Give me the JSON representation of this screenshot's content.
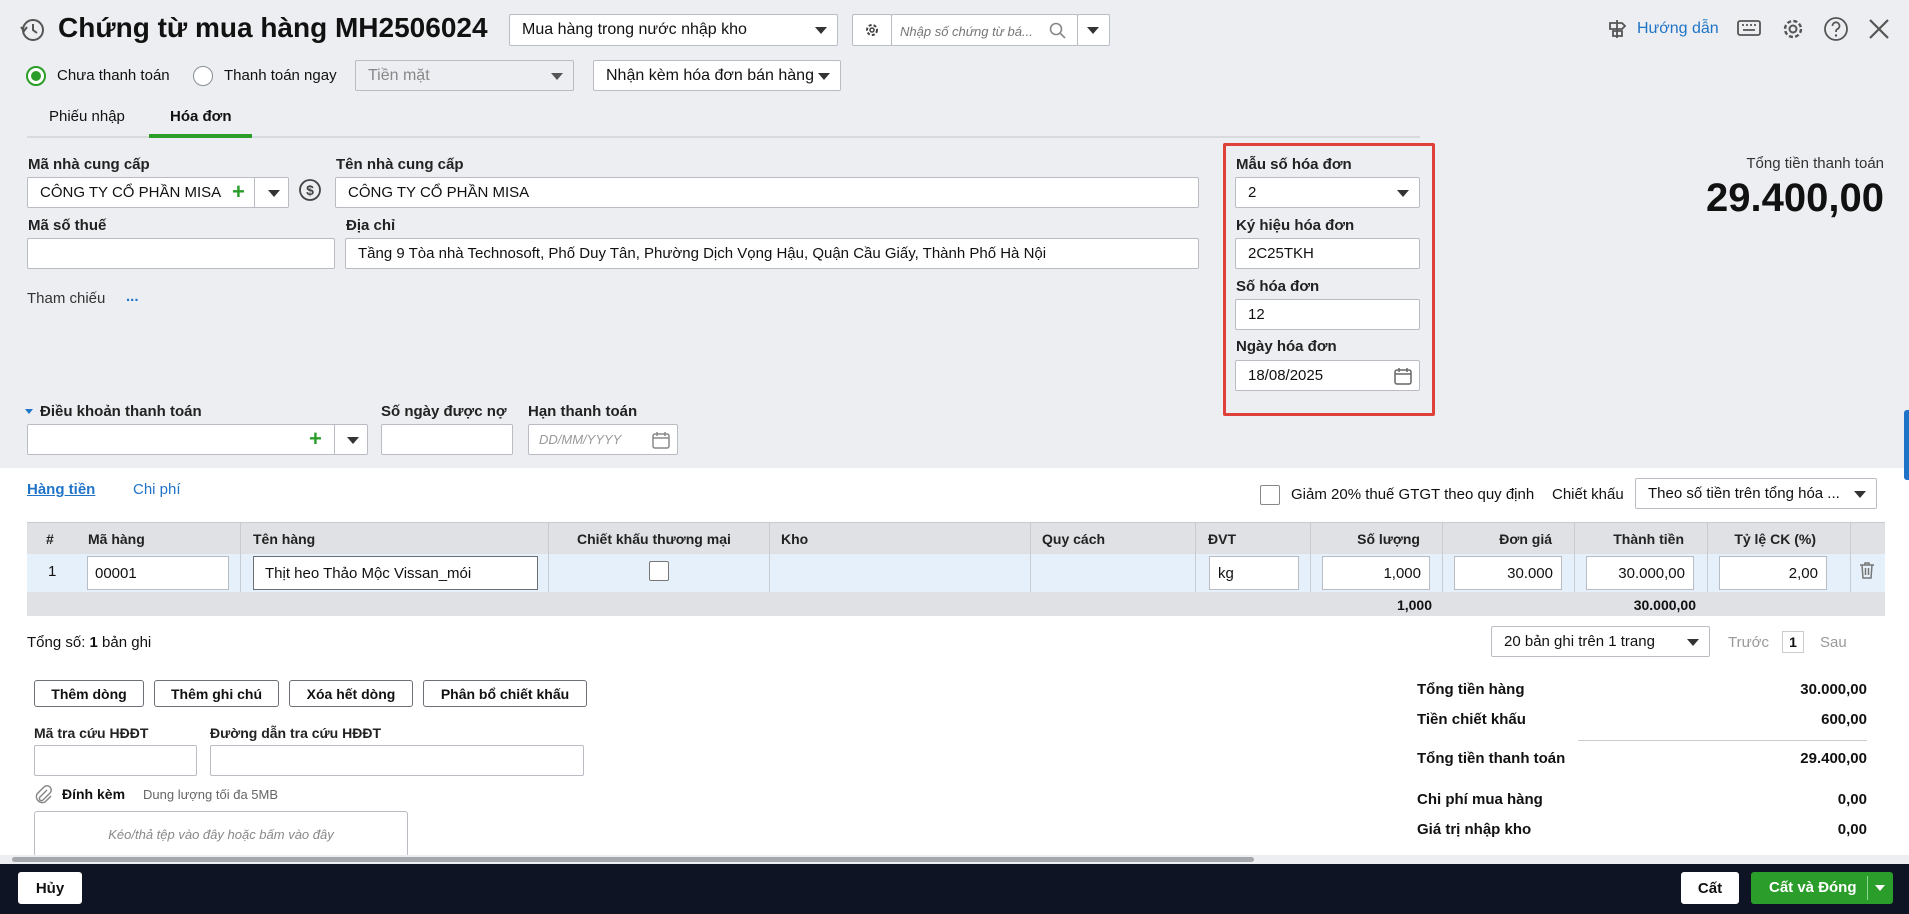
{
  "header": {
    "title": "Chứng từ mua hàng MH2506024",
    "type_select": "Mua hàng trong nước nhập kho",
    "search_placeholder": "Nhập số chứng từ bá...",
    "help_link": "Hướng dẫn"
  },
  "payment": {
    "option_unpaid": "Chưa thanh toán",
    "option_paid_now": "Thanh toán ngay",
    "method": "Tiền mặt",
    "invoice_receive": "Nhận kèm hóa đơn bán hàng"
  },
  "tabs": {
    "receipt": "Phiếu nhập",
    "invoice": "Hóa đơn"
  },
  "supplier": {
    "code_label": "Mã nhà cung cấp",
    "code_value": "CÔNG TY CỔ PHẦN MISA",
    "name_label": "Tên nhà cung cấp",
    "name_value": "CÔNG TY CỔ PHẦN MISA",
    "tax_label": "Mã số thuế",
    "tax_value": "",
    "address_label": "Địa chỉ",
    "address_value": "Tầng 9 Tòa nhà Technosoft, Phố Duy Tân, Phường Dịch Vọng Hậu, Quận Cầu Giấy, Thành Phố Hà Nội",
    "reference_label": "Tham chiếu",
    "reference_more": "..."
  },
  "invoice_info": {
    "form_label": "Mẫu số hóa đơn",
    "form_value": "2",
    "symbol_label": "Ký hiệu hóa đơn",
    "symbol_value": "2C25TKH",
    "number_label": "Số hóa đơn",
    "number_value": "12",
    "date_label": "Ngày hóa đơn",
    "date_value": "18/08/2025"
  },
  "total": {
    "label": "Tổng tiền thanh toán",
    "value": "29.400,00"
  },
  "terms": {
    "terms_label": "Điều khoản thanh toán",
    "days_label": "Số ngày được nợ",
    "due_label": "Hạn thanh toán",
    "due_placeholder": "DD/MM/YYYY"
  },
  "detail_tabs": {
    "goods": "Hàng tiền",
    "cost": "Chi phí"
  },
  "options": {
    "vat_reduce": "Giảm 20% thuế GTGT theo quy định",
    "discount_label": "Chiết khấu",
    "discount_value": "Theo số tiền trên tổng hóa ..."
  },
  "grid": {
    "columns": {
      "idx": "#",
      "code": "Mã hàng",
      "name": "Tên hàng",
      "trade_discount": "Chiết khấu thương mại",
      "warehouse": "Kho",
      "spec": "Quy cách",
      "unit": "ĐVT",
      "qty": "Số lượng",
      "price": "Đơn giá",
      "amount": "Thành tiền",
      "rate": "Tỷ lệ CK (%)"
    },
    "rows": [
      {
        "idx": "1",
        "code": "00001",
        "name": "Thịt heo Thảo Mộc Vissan_mói",
        "unit": "kg",
        "qty": "1,000",
        "price": "30.000",
        "amount": "30.000,00",
        "rate": "2,00"
      }
    ],
    "totals": {
      "qty": "1,000",
      "amount": "30.000,00"
    }
  },
  "paging": {
    "count_prefix": "Tổng số: ",
    "count": "1",
    "count_suffix": " bản ghi",
    "page_size": "20 bản ghi trên 1 trang",
    "prev": "Trước",
    "page": "1",
    "next": "Sau"
  },
  "actions": {
    "add_row": "Thêm dòng",
    "add_note": "Thêm ghi chú",
    "delete_all": "Xóa hết dòng",
    "allocate_discount": "Phân bổ chiết khấu"
  },
  "einvoice": {
    "lookup_code_label": "Mã tra cứu HĐĐT",
    "lookup_url_label": "Đường dẫn tra cứu HĐĐT",
    "attach_label": "Đính kèm",
    "attach_limit": "Dung lượng tối đa 5MB",
    "drop_hint": "Kéo/thả tệp vào đây hoặc bấm vào đây"
  },
  "summary": {
    "goods_label": "Tổng tiền hàng",
    "goods_value": "30.000,00",
    "discount_label": "Tiền chiết khấu",
    "discount_value": "600,00",
    "pay_label": "Tổng tiền thanh toán",
    "pay_value": "29.400,00",
    "cost_label": "Chi phí mua hàng",
    "cost_value": "0,00",
    "stock_label": "Giá trị nhập kho",
    "stock_value": "0,00"
  },
  "footer": {
    "cancel": "Hủy",
    "save": "Cất",
    "save_close": "Cất và Đóng"
  },
  "colors": {
    "accent": "#2a9d2a",
    "highlight": "#e0403a",
    "footer_bg": "#0e1424",
    "link": "#1f74c8"
  }
}
